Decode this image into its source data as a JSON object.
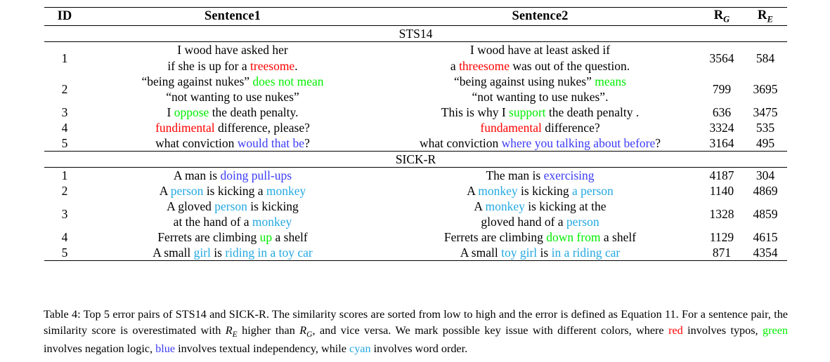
{
  "table": {
    "headers": {
      "id": "ID",
      "sentence1": "Sentence1",
      "sentence2": "Sentence2",
      "rg_base": "R",
      "rg_sub": "G",
      "re_base": "R",
      "re_sub": "E"
    },
    "sections": [
      {
        "name": "STS14",
        "rows": [
          {
            "id": "1",
            "s1_line1": [
              {
                "t": "I wood have asked her",
                "c": "plain"
              }
            ],
            "s1_line2": [
              {
                "t": "if she is up for a ",
                "c": "plain"
              },
              {
                "t": "treesome",
                "c": "red"
              },
              {
                "t": ".",
                "c": "plain"
              }
            ],
            "s2_line1": [
              {
                "t": "I wood have at least asked if",
                "c": "plain"
              }
            ],
            "s2_line2": [
              {
                "t": "a ",
                "c": "plain"
              },
              {
                "t": "threesome",
                "c": "red"
              },
              {
                "t": " was out of the question.",
                "c": "plain"
              }
            ],
            "rg": "3564",
            "re": "584"
          },
          {
            "id": "2",
            "s1_line1": [
              {
                "t": "“being against nukes” ",
                "c": "plain"
              },
              {
                "t": "does not mean",
                "c": "green"
              }
            ],
            "s1_line2": [
              {
                "t": "“not wanting to use nukes”",
                "c": "plain"
              }
            ],
            "s2_line1": [
              {
                "t": "“being against using nukes” ",
                "c": "plain"
              },
              {
                "t": "means",
                "c": "green"
              }
            ],
            "s2_line2": [
              {
                "t": "“not wanting to use nukes”.",
                "c": "plain"
              }
            ],
            "rg": "799",
            "re": "3695"
          },
          {
            "id": "3",
            "s1_line1": [
              {
                "t": "I ",
                "c": "plain"
              },
              {
                "t": "oppose",
                "c": "green"
              },
              {
                "t": " the death penalty.",
                "c": "plain"
              }
            ],
            "s1_line2": [],
            "s2_line1": [
              {
                "t": "This is why I ",
                "c": "plain"
              },
              {
                "t": "support",
                "c": "green"
              },
              {
                "t": " the death penalty .",
                "c": "plain"
              }
            ],
            "s2_line2": [],
            "rg": "636",
            "re": "3475"
          },
          {
            "id": "4",
            "s1_line1": [
              {
                "t": "fundimental",
                "c": "red"
              },
              {
                "t": " difference, please?",
                "c": "plain"
              }
            ],
            "s1_line2": [],
            "s2_line1": [
              {
                "t": "fundamental",
                "c": "red"
              },
              {
                "t": " difference?",
                "c": "plain"
              }
            ],
            "s2_line2": [],
            "rg": "3324",
            "re": "535"
          },
          {
            "id": "5",
            "s1_line1": [
              {
                "t": "what conviction ",
                "c": "plain"
              },
              {
                "t": "would that be",
                "c": "blue"
              },
              {
                "t": "?",
                "c": "plain"
              }
            ],
            "s1_line2": [],
            "s2_line1": [
              {
                "t": "what conviction ",
                "c": "plain"
              },
              {
                "t": "where you talking about before",
                "c": "blue"
              },
              {
                "t": "?",
                "c": "plain"
              }
            ],
            "s2_line2": [],
            "rg": "3164",
            "re": "495"
          }
        ]
      },
      {
        "name": "SICK-R",
        "rows": [
          {
            "id": "1",
            "s1_line1": [
              {
                "t": "A man is ",
                "c": "plain"
              },
              {
                "t": "doing pull-ups",
                "c": "blue"
              }
            ],
            "s1_line2": [],
            "s2_line1": [
              {
                "t": "The man is ",
                "c": "plain"
              },
              {
                "t": "exercising",
                "c": "blue"
              }
            ],
            "s2_line2": [],
            "rg": "4187",
            "re": "304"
          },
          {
            "id": "2",
            "s1_line1": [
              {
                "t": "A ",
                "c": "plain"
              },
              {
                "t": "person",
                "c": "cyan"
              },
              {
                "t": " is kicking a ",
                "c": "plain"
              },
              {
                "t": "monkey",
                "c": "cyan"
              }
            ],
            "s1_line2": [],
            "s2_line1": [
              {
                "t": "A ",
                "c": "plain"
              },
              {
                "t": "monkey",
                "c": "cyan"
              },
              {
                "t": " is kicking ",
                "c": "plain"
              },
              {
                "t": "a person",
                "c": "cyan"
              }
            ],
            "s2_line2": [],
            "rg": "1140",
            "re": "4869"
          },
          {
            "id": "3",
            "s1_line1": [
              {
                "t": "A gloved ",
                "c": "plain"
              },
              {
                "t": "person",
                "c": "cyan"
              },
              {
                "t": " is kicking",
                "c": "plain"
              }
            ],
            "s1_line2": [
              {
                "t": "at the hand of a ",
                "c": "plain"
              },
              {
                "t": "monkey",
                "c": "cyan"
              }
            ],
            "s2_line1": [
              {
                "t": "A ",
                "c": "plain"
              },
              {
                "t": "monkey",
                "c": "cyan"
              },
              {
                "t": " is kicking at the",
                "c": "plain"
              }
            ],
            "s2_line2": [
              {
                "t": "gloved hand of a ",
                "c": "plain"
              },
              {
                "t": "person",
                "c": "cyan"
              }
            ],
            "rg": "1328",
            "re": "4859"
          },
          {
            "id": "4",
            "s1_line1": [
              {
                "t": "Ferrets are climbing ",
                "c": "plain"
              },
              {
                "t": "up",
                "c": "green"
              },
              {
                "t": " a shelf",
                "c": "plain"
              }
            ],
            "s1_line2": [],
            "s2_line1": [
              {
                "t": "Ferrets are climbing ",
                "c": "plain"
              },
              {
                "t": "down from",
                "c": "green"
              },
              {
                "t": " a shelf",
                "c": "plain"
              }
            ],
            "s2_line2": [],
            "rg": "1129",
            "re": "4615"
          },
          {
            "id": "5",
            "s1_line1": [
              {
                "t": "A small ",
                "c": "plain"
              },
              {
                "t": "girl",
                "c": "cyan"
              },
              {
                "t": " is ",
                "c": "plain"
              },
              {
                "t": "riding in a toy car",
                "c": "cyan"
              }
            ],
            "s1_line2": [],
            "s2_line1": [
              {
                "t": "A small ",
                "c": "plain"
              },
              {
                "t": "toy girl",
                "c": "cyan"
              },
              {
                "t": " is ",
                "c": "plain"
              },
              {
                "t": "in a riding car",
                "c": "cyan"
              }
            ],
            "s2_line2": [],
            "rg": "871",
            "re": "4354"
          }
        ]
      }
    ]
  },
  "caption": {
    "parts": [
      {
        "t": "Table 4: Top 5 error pairs of STS14 and SICK-R. The similarity scores are sorted from low to high and the error is defined as Equation 11. For a sentence pair, the similarity score is overestimated with ",
        "c": "plain"
      },
      {
        "t": "R",
        "c": "math",
        "sub": "E"
      },
      {
        "t": " higher than ",
        "c": "plain"
      },
      {
        "t": "R",
        "c": "math",
        "sub": "G"
      },
      {
        "t": ", and vice versa. We mark possible key issue with different colors, where ",
        "c": "plain"
      },
      {
        "t": "red",
        "c": "red"
      },
      {
        "t": " involves typos, ",
        "c": "plain"
      },
      {
        "t": "green",
        "c": "green"
      },
      {
        "t": " involves negation logic, ",
        "c": "plain"
      },
      {
        "t": "blue",
        "c": "blue"
      },
      {
        "t": " involves textual independency, while ",
        "c": "plain"
      },
      {
        "t": "cyan",
        "c": "cyan"
      },
      {
        "t": " involves word order.",
        "c": "plain"
      }
    ]
  },
  "colors": {
    "red": "#ff0000",
    "green": "#00ee00",
    "blue": "#3b3bf5",
    "cyan": "#23a8e0",
    "text": "#000000",
    "background": "#ffffff"
  }
}
